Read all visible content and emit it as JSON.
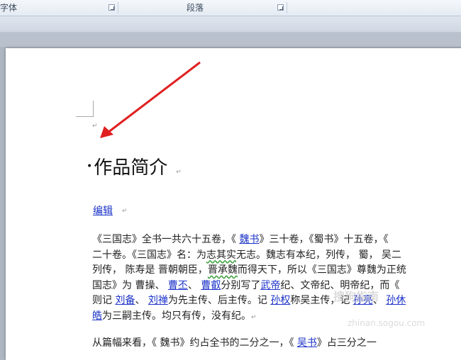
{
  "ribbon": {
    "groups": [
      {
        "label": "字体"
      },
      {
        "label": "段落"
      }
    ]
  },
  "document": {
    "heading": "作品简介",
    "edit_link": "编辑",
    "paragraph_lines": [
      [
        {
          "t": "《三国志》全书一共六十五卷，《 "
        },
        {
          "t": "魏书",
          "link": true
        },
        {
          "t": "》三十卷，《蜀书》十五卷，《"
        }
      ],
      [
        {
          "t": "二十卷。《三国志》名：为"
        },
        {
          "t": "志其实",
          "wavy": true
        },
        {
          "t": "无志。魏志有本纪，列传，  蜀，  吴二"
        }
      ],
      [
        {
          "t": "列传，  陈寿是 晋朝朝臣，"
        },
        {
          "t": "晋承魏",
          "wavy": true
        },
        {
          "t": "而得天下，所以《三国志》尊魏为正统"
        }
      ],
      [
        {
          "t": "国志》为 曹操、 "
        },
        {
          "t": "曹丕",
          "link": true
        },
        {
          "t": "、 "
        },
        {
          "t": "曹叡",
          "link": true
        },
        {
          "t": "分别写了"
        },
        {
          "t": "武帝",
          "link": true
        },
        {
          "t": "纪、文帝纪、明帝纪，而《"
        }
      ],
      [
        {
          "t": "则记 "
        },
        {
          "t": "刘备",
          "link": true
        },
        {
          "t": "、 "
        },
        {
          "t": "刘禅",
          "link": true
        },
        {
          "t": "为先主传、后主传。记 "
        },
        {
          "t": "孙权",
          "link": true
        },
        {
          "t": "称吴主传，记 "
        },
        {
          "t": "孙亮",
          "link": true
        },
        {
          "t": "、 "
        },
        {
          "t": "孙休",
          "link": true
        }
      ],
      [
        {
          "t": "皓",
          "link": true
        },
        {
          "t": "为三嗣主传。均只有传，没有纪。"
        }
      ]
    ],
    "next_paragraph": [
      {
        "t": "从篇幅来看，《 魏书》约占全书的二分之一，《 "
      },
      {
        "t": "吴书",
        "link": true
      },
      {
        "t": "》占三分之一"
      }
    ],
    "paragraph_mark": "↵"
  },
  "watermark": {
    "line1": "搜狗指南",
    "line2": "zhinan.sogou.com"
  },
  "colors": {
    "link": "#1a32c8",
    "arrow": "#e02020",
    "page": "#ffffff",
    "workspace": "#aeb6c2"
  }
}
